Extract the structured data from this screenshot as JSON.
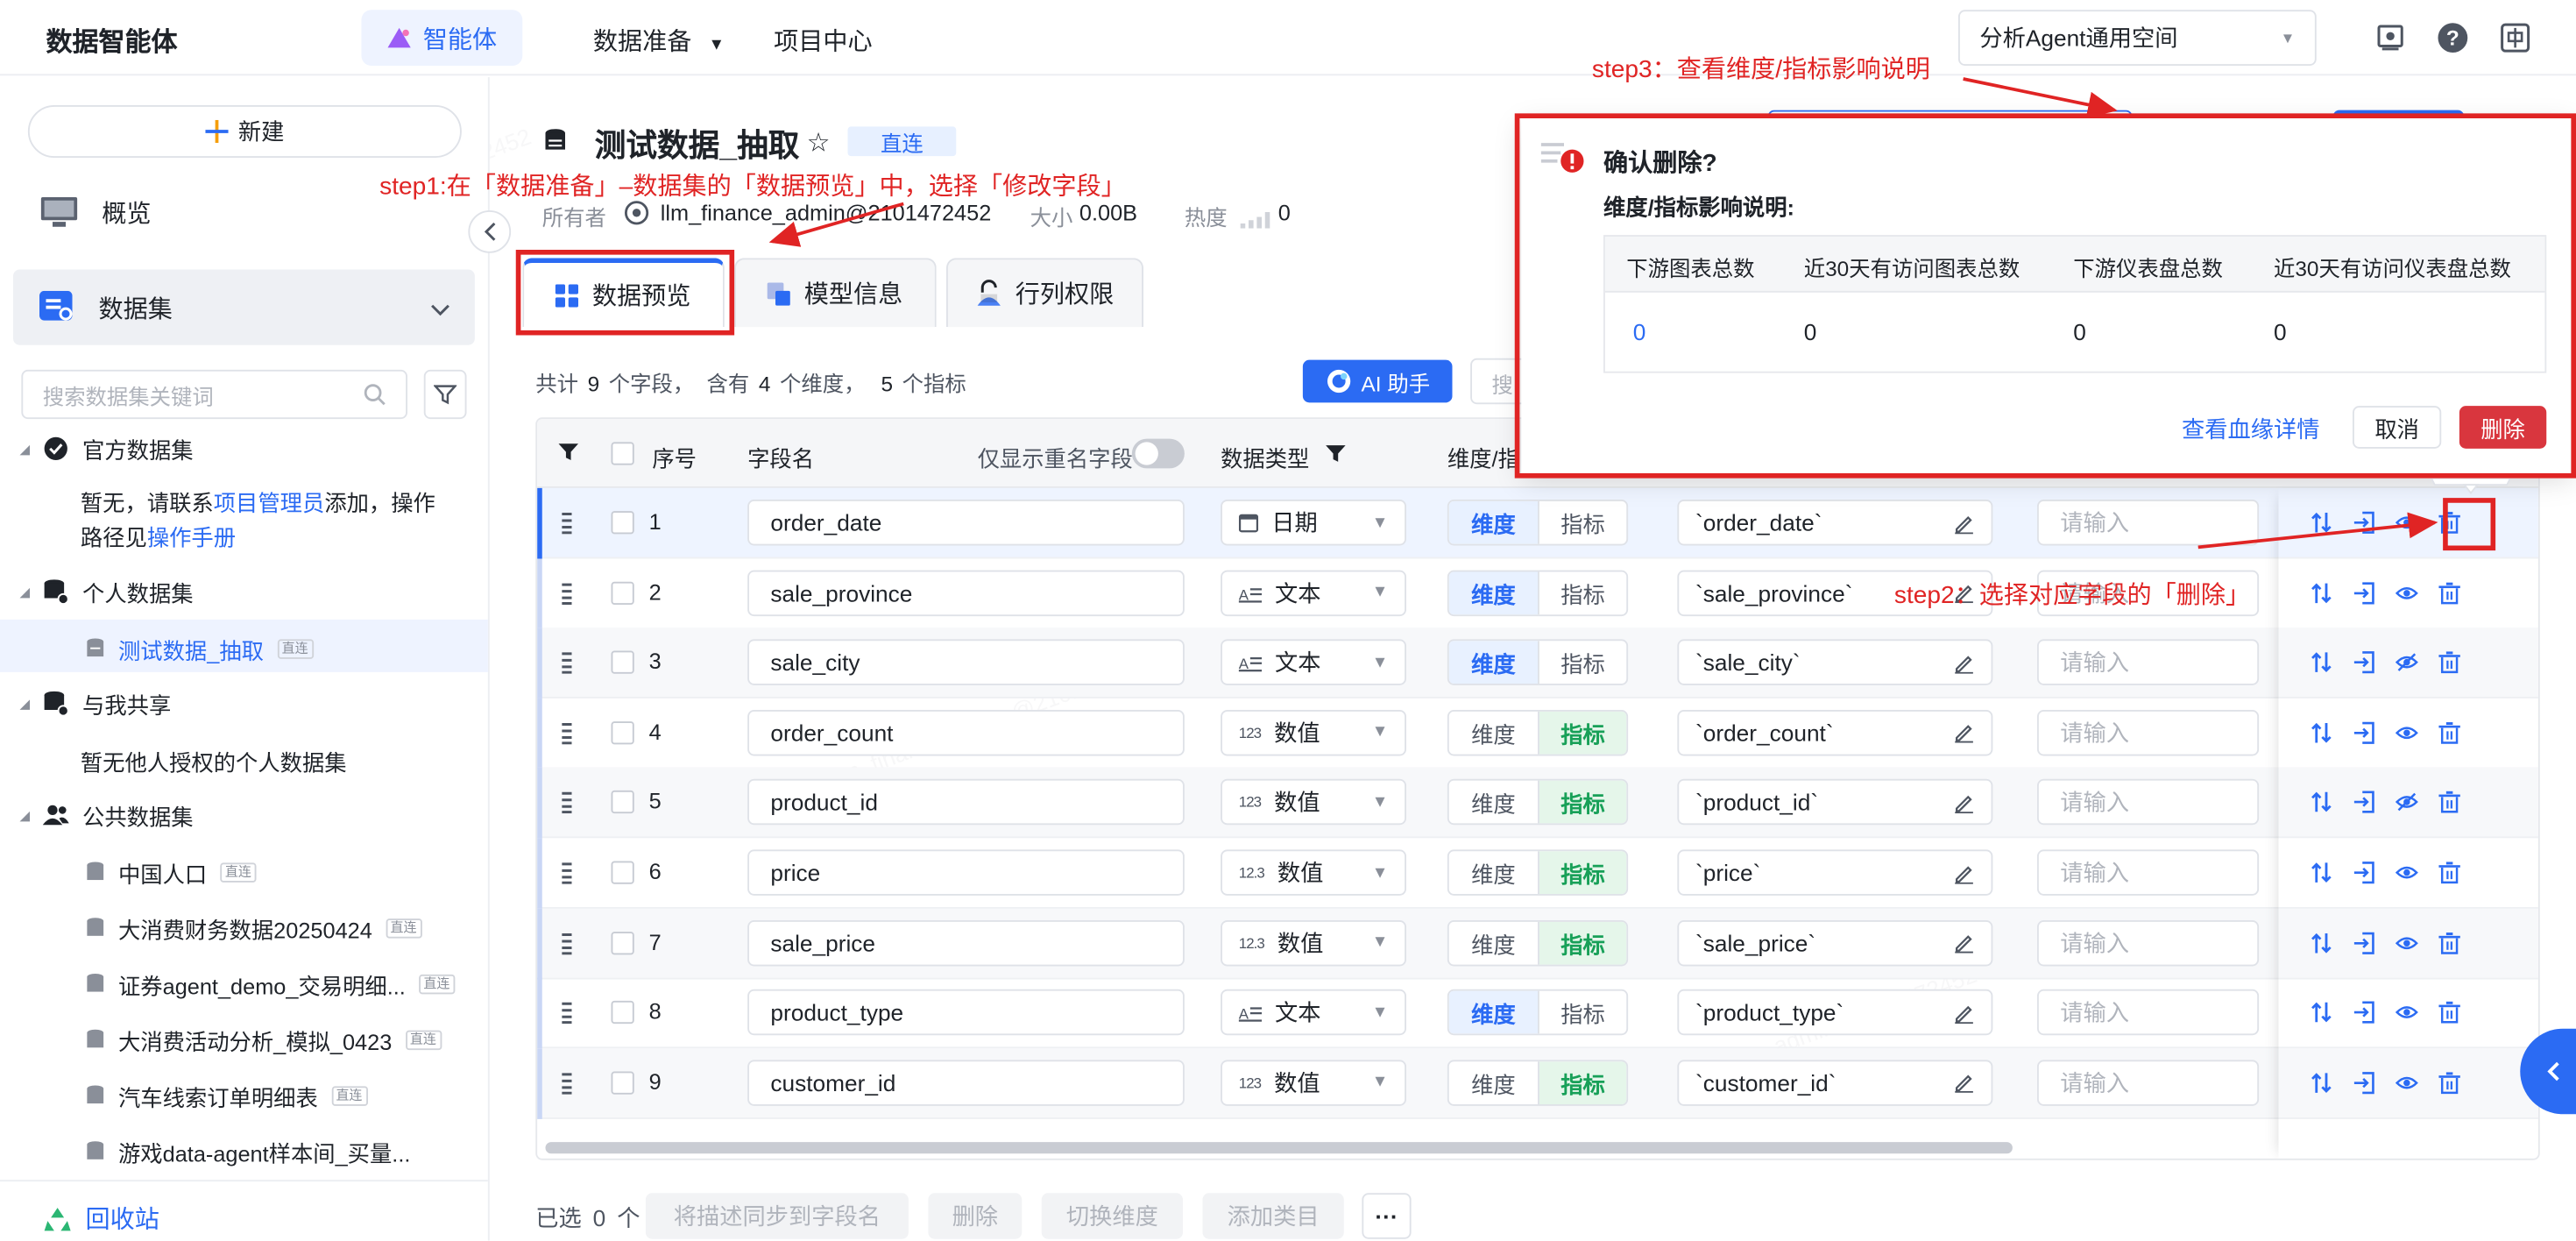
{
  "app": {
    "brand": "数据智能体"
  },
  "topnav": {
    "agent": "智能体",
    "data_prep": "数据准备",
    "projects": "项目中心",
    "space": "分析Agent通用空间"
  },
  "sidebar": {
    "new_button": "新建",
    "overview": "概览",
    "datasets": "数据集",
    "search_placeholder": "搜索数据集关键词",
    "official": "官方数据集",
    "official_empty_prefix": "暂无，请联系",
    "official_link_admin": "项目管理员",
    "official_empty_mid": "添加，操作",
    "official_empty_line2": "路径见",
    "official_link_manual": "操作手册",
    "personal": "个人数据集",
    "personal_item": "测试数据_抽取",
    "shared": "与我共享",
    "shared_empty": "暂无他人授权的个人数据集",
    "public": "公共数据集",
    "public_items": [
      "中国人口",
      "大消费财务数据20250424",
      "证券agent_demo_交易明细...",
      "大消费活动分析_模拟_0423",
      "汽车线索订单明细表",
      "游戏data-agent样本间_买量..."
    ],
    "badge": "直连",
    "recycle": "回收站"
  },
  "dataset": {
    "title": "测试数据_抽取",
    "badge": "直连",
    "owner_label": "所有者",
    "owner": "llm_finance_admin@2101472452",
    "size_label": "大小",
    "size": "0.00B",
    "heat_label": "热度",
    "heat": "0"
  },
  "tabs": [
    "数据预览",
    "模型信息",
    "行列权限"
  ],
  "summary": {
    "total": "共计",
    "fields": "9",
    "fields_unit": "个字段，",
    "contains": "含有",
    "dims": "4",
    "dims_unit": "个维度，",
    "metrics": "5",
    "metrics_unit": "个指标"
  },
  "ai_button": "AI 助手",
  "search_partial": "搜",
  "table": {
    "headers": {
      "seq": "序号",
      "field": "字段名",
      "dup_only": "仅显示重名字段",
      "dtype": "数据类型",
      "dim_metric": "维度/指"
    },
    "dim_label": "维度",
    "metric_label": "指标",
    "desc_placeholder": "请输入",
    "rows": [
      {
        "seq": "1",
        "name": "order_date",
        "type": "日期",
        "type_icon": "calendar-icon",
        "role": "dim",
        "expr": "`order_date`"
      },
      {
        "seq": "2",
        "name": "sale_province",
        "type": "文本",
        "type_icon": "text-icon",
        "role": "dim",
        "expr": "`sale_province`"
      },
      {
        "seq": "3",
        "name": "sale_city",
        "type": "文本",
        "type_icon": "text-icon",
        "role": "dim",
        "expr": "`sale_city`"
      },
      {
        "seq": "4",
        "name": "order_count",
        "type": "数值",
        "type_icon": "123",
        "role": "metric",
        "expr": "`order_count`"
      },
      {
        "seq": "5",
        "name": "product_id",
        "type": "数值",
        "type_icon": "123",
        "role": "metric",
        "expr": "`product_id`"
      },
      {
        "seq": "6",
        "name": "price",
        "type": "数值",
        "type_icon": "12.3",
        "role": "metric",
        "expr": "`price`"
      },
      {
        "seq": "7",
        "name": "sale_price",
        "type": "数值",
        "type_icon": "12.3",
        "role": "metric",
        "expr": "`sale_price`"
      },
      {
        "seq": "8",
        "name": "product_type",
        "type": "文本",
        "type_icon": "text-icon",
        "role": "dim",
        "expr": "`product_type`"
      },
      {
        "seq": "9",
        "name": "customer_id",
        "type": "数值",
        "type_icon": "123",
        "role": "metric",
        "expr": "`customer_id`"
      }
    ]
  },
  "bottom": {
    "selected": "已选",
    "selected_count": "0",
    "selected_unit": "个",
    "sync": "将描述同步到字段名",
    "delete": "删除",
    "switch": "切换维度",
    "add_category": "添加类目",
    "more": "···"
  },
  "dialog": {
    "title": "确认删除?",
    "subtitle": "维度/指标影响说明:",
    "cols": [
      "下游图表总数",
      "近30天有访问图表总数",
      "下游仪表盘总数",
      "近30天有访问仪表盘总数"
    ],
    "vals": [
      "0",
      "0",
      "0",
      "0"
    ],
    "lineage": "查看血缘详情",
    "cancel": "取消",
    "delete": "删除"
  },
  "annotations": {
    "step1": "step1:在「数据准备」–数据集的「数据预览」中，选择「修改字段」",
    "step2": "step2：选择对应字段的「删除」",
    "step3": "step3：查看维度/指标影响说明"
  },
  "watermark": "llm_finance_admin@2101472452",
  "colors": {
    "primary": "#2b6bf3",
    "danger": "#e02424",
    "metric": "#18a058"
  }
}
